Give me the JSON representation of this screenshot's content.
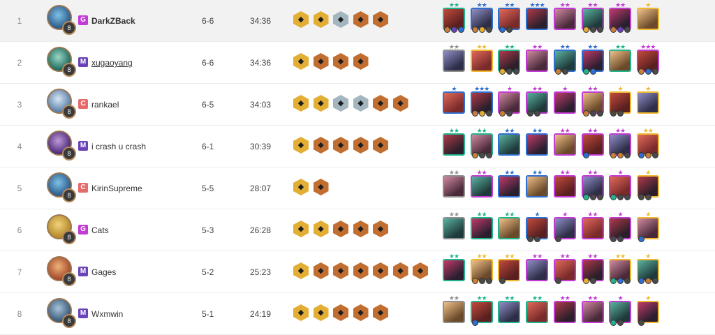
{
  "colors": {
    "tier_g": "#c23bd4",
    "tier_m": "#6a43b8",
    "tier_c": "#e66a6a",
    "cost_1": "#8f8f8f",
    "cost_2": "#20b38c",
    "cost_3": "#2f6fd1",
    "cost_4": "#c13bd2",
    "cost_5": "#f0b82e"
  },
  "rows": [
    {
      "rank": "1",
      "level": "8",
      "tier": "G",
      "name": "DarkZBack",
      "record": "6-6",
      "time": "34:36",
      "traits": [
        {
          "tone": "gold",
          "icon": "trait-icon"
        },
        {
          "tone": "gold",
          "icon": "trait-icon"
        },
        {
          "tone": "silver",
          "icon": "trait-icon"
        },
        {
          "tone": "bronze",
          "icon": "trait-icon"
        },
        {
          "tone": "bronze",
          "icon": "trait-icon"
        }
      ],
      "units": [
        {
          "cost": 2,
          "stars": "★★",
          "items": [
            "#c97f3a",
            "#6a43b8",
            "#2f6fd1"
          ]
        },
        {
          "cost": 3,
          "stars": "★★",
          "items": [
            "#c97f3a",
            "#e3ae34",
            "#4a4a4a"
          ]
        },
        {
          "cost": 3,
          "stars": "★★",
          "items": [
            "#2f6fd1",
            "#4a4a4a"
          ]
        },
        {
          "cost": 3,
          "stars": "★★★",
          "items": []
        },
        {
          "cost": 4,
          "stars": "★★",
          "items": []
        },
        {
          "cost": 4,
          "stars": "★★",
          "items": [
            "#e3ae34",
            "#4a4a4a",
            "#4a4a4a"
          ]
        },
        {
          "cost": 4,
          "stars": "★★",
          "items": [
            "#c97f3a",
            "#6a43b8",
            "#4a4a4a"
          ]
        },
        {
          "cost": 5,
          "stars": "★",
          "items": []
        }
      ]
    },
    {
      "rank": "2",
      "level": "8",
      "tier": "M",
      "name": "xugaoyang",
      "record": "6-6",
      "time": "34:36",
      "traits": [
        {
          "tone": "gold",
          "icon": "trait-icon"
        },
        {
          "tone": "bronze",
          "icon": "trait-icon"
        },
        {
          "tone": "bronze",
          "icon": "trait-icon"
        },
        {
          "tone": "bronze",
          "icon": "trait-icon"
        }
      ],
      "units": [
        {
          "cost": 1,
          "stars": "★★",
          "items": []
        },
        {
          "cost": 5,
          "stars": "★★",
          "items": []
        },
        {
          "cost": 2,
          "stars": "★★",
          "items": [
            "#e3ae34",
            "#4a4a4a",
            "#4a4a4a"
          ]
        },
        {
          "cost": 4,
          "stars": "★★",
          "items": []
        },
        {
          "cost": 3,
          "stars": "★★",
          "items": [
            "#c97f3a",
            "#4a4a4a"
          ]
        },
        {
          "cost": 3,
          "stars": "★★",
          "items": [
            "#20b38c",
            "#2f6fd1"
          ]
        },
        {
          "cost": 2,
          "stars": "★★",
          "items": []
        },
        {
          "cost": 4,
          "stars": "★★★",
          "items": [
            "#c97f3a",
            "#2f6fd1",
            "#4a4a4a"
          ]
        }
      ]
    },
    {
      "rank": "3",
      "level": "8",
      "tier": "C",
      "name": "rankael",
      "record": "6-5",
      "time": "34:03",
      "traits": [
        {
          "tone": "gold",
          "icon": "trait-icon"
        },
        {
          "tone": "gold",
          "icon": "trait-icon"
        },
        {
          "tone": "silver",
          "icon": "trait-icon"
        },
        {
          "tone": "silver",
          "icon": "trait-icon"
        },
        {
          "tone": "bronze",
          "icon": "trait-icon"
        },
        {
          "tone": "bronze",
          "icon": "trait-icon"
        }
      ],
      "units": [
        {
          "cost": 3,
          "stars": "★",
          "items": []
        },
        {
          "cost": 3,
          "stars": "★★★",
          "items": [
            "#c97f3a",
            "#e3ae34",
            "#4a4a4a"
          ]
        },
        {
          "cost": 4,
          "stars": "★",
          "items": [
            "#c97f3a",
            "#4a4a4a"
          ]
        },
        {
          "cost": 4,
          "stars": "★★",
          "items": [
            "#4a4a4a",
            "#4a4a4a"
          ]
        },
        {
          "cost": 4,
          "stars": "★",
          "items": []
        },
        {
          "cost": 4,
          "stars": "★★",
          "items": [
            "#c97f3a",
            "#4a4a4a",
            "#4a4a4a"
          ]
        },
        {
          "cost": 5,
          "stars": "★",
          "items": [
            "#4a4a4a",
            "#4a4a4a"
          ]
        },
        {
          "cost": 5,
          "stars": "★",
          "items": []
        }
      ]
    },
    {
      "rank": "4",
      "level": "8",
      "tier": "M",
      "name": "i crash u crash",
      "record": "6-1",
      "time": "30:39",
      "traits": [
        {
          "tone": "gold",
          "icon": "trait-icon"
        },
        {
          "tone": "bronze",
          "icon": "trait-icon"
        },
        {
          "tone": "bronze",
          "icon": "trait-icon"
        },
        {
          "tone": "bronze",
          "icon": "trait-icon"
        },
        {
          "tone": "bronze",
          "icon": "trait-icon"
        }
      ],
      "units": [
        {
          "cost": 2,
          "stars": "★★",
          "items": []
        },
        {
          "cost": 2,
          "stars": "★★",
          "items": [
            "#c97f3a",
            "#4a4a4a",
            "#4a4a4a"
          ]
        },
        {
          "cost": 3,
          "stars": "★★",
          "items": []
        },
        {
          "cost": 3,
          "stars": "★★",
          "items": []
        },
        {
          "cost": 4,
          "stars": "★★",
          "items": []
        },
        {
          "cost": 4,
          "stars": "★★",
          "items": [
            "#2f6fd1"
          ]
        },
        {
          "cost": 4,
          "stars": "★★",
          "items": [
            "#c97f3a",
            "#c97f3a",
            "#4a4a4a"
          ]
        },
        {
          "cost": 5,
          "stars": "★★",
          "items": [
            "#2f6fd1",
            "#c97f3a",
            "#4a4a4a"
          ]
        }
      ]
    },
    {
      "rank": "5",
      "level": "8",
      "tier": "C",
      "name": "KirinSupreme",
      "record": "5-5",
      "time": "28:07",
      "traits": [
        {
          "tone": "gold",
          "icon": "trait-icon"
        },
        {
          "tone": "bronze",
          "icon": "trait-icon"
        }
      ],
      "units": [
        {
          "cost": 1,
          "stars": "★★",
          "items": []
        },
        {
          "cost": 4,
          "stars": "★★",
          "items": []
        },
        {
          "cost": 3,
          "stars": "★★",
          "items": []
        },
        {
          "cost": 3,
          "stars": "★★",
          "items": []
        },
        {
          "cost": 4,
          "stars": "★★",
          "items": []
        },
        {
          "cost": 4,
          "stars": "★★",
          "items": [
            "#20b38c",
            "#4a4a4a",
            "#4a4a4a"
          ]
        },
        {
          "cost": 4,
          "stars": "★",
          "items": [
            "#20b38c",
            "#4a4a4a",
            "#4a4a4a"
          ]
        },
        {
          "cost": 5,
          "stars": "★",
          "items": [
            "#4a4a4a",
            "#4a4a4a"
          ]
        }
      ]
    },
    {
      "rank": "6",
      "level": "8",
      "tier": "G",
      "name": "Cats",
      "record": "5-3",
      "time": "26:28",
      "traits": [
        {
          "tone": "gold",
          "icon": "trait-icon"
        },
        {
          "tone": "gold",
          "icon": "trait-icon"
        },
        {
          "tone": "bronze",
          "icon": "trait-icon"
        },
        {
          "tone": "bronze",
          "icon": "trait-icon"
        },
        {
          "tone": "bronze",
          "icon": "trait-icon"
        }
      ],
      "units": [
        {
          "cost": 1,
          "stars": "★★",
          "items": []
        },
        {
          "cost": 2,
          "stars": "★★",
          "items": []
        },
        {
          "cost": 2,
          "stars": "★★",
          "items": []
        },
        {
          "cost": 3,
          "stars": "★",
          "items": [
            "#4a4a4a",
            "#4a4a4a"
          ]
        },
        {
          "cost": 4,
          "stars": "★",
          "items": [
            "#4a4a4a"
          ]
        },
        {
          "cost": 4,
          "stars": "★★",
          "items": []
        },
        {
          "cost": 4,
          "stars": "★",
          "items": [
            "#4a4a4a",
            "#4a4a4a"
          ]
        },
        {
          "cost": 5,
          "stars": "★",
          "items": [
            "#2f6fd1"
          ]
        }
      ]
    },
    {
      "rank": "7",
      "level": "8",
      "tier": "M",
      "name": "Gages",
      "record": "5-2",
      "time": "25:23",
      "traits": [
        {
          "tone": "gold",
          "icon": "trait-icon"
        },
        {
          "tone": "bronze",
          "icon": "trait-icon"
        },
        {
          "tone": "bronze",
          "icon": "trait-icon"
        },
        {
          "tone": "bronze",
          "icon": "trait-icon"
        },
        {
          "tone": "bronze",
          "icon": "trait-icon"
        },
        {
          "tone": "bronze",
          "icon": "trait-icon"
        },
        {
          "tone": "bronze",
          "icon": "trait-icon"
        }
      ],
      "units": [
        {
          "cost": 2,
          "stars": "★★",
          "items": []
        },
        {
          "cost": 5,
          "stars": "★★",
          "items": [
            "#c97f3a",
            "#4a4a4a",
            "#4a4a4a"
          ]
        },
        {
          "cost": 5,
          "stars": "★★",
          "items": [
            "#4a4a4a"
          ]
        },
        {
          "cost": 4,
          "stars": "★★",
          "items": []
        },
        {
          "cost": 4,
          "stars": "★★",
          "items": [
            "#4a4a4a"
          ]
        },
        {
          "cost": 4,
          "stars": "★★",
          "items": [
            "#e3ae34",
            "#4a4a4a"
          ]
        },
        {
          "cost": 5,
          "stars": "★★",
          "items": [
            "#20b38c",
            "#2f6fd1",
            "#4a4a4a"
          ]
        },
        {
          "cost": 5,
          "stars": "★",
          "items": [
            "#2f6fd1",
            "#c97f3a",
            "#4a4a4a"
          ]
        }
      ]
    },
    {
      "rank": "8",
      "level": "8",
      "tier": "M",
      "name": "Wxmwin",
      "record": "5-1",
      "time": "24:19",
      "traits": [
        {
          "tone": "gold",
          "icon": "trait-icon"
        },
        {
          "tone": "gold",
          "icon": "trait-icon"
        },
        {
          "tone": "bronze",
          "icon": "trait-icon"
        },
        {
          "tone": "bronze",
          "icon": "trait-icon"
        },
        {
          "tone": "bronze",
          "icon": "trait-icon"
        }
      ],
      "units": [
        {
          "cost": 1,
          "stars": "★★",
          "items": []
        },
        {
          "cost": 2,
          "stars": "★★",
          "items": [
            "#2f6fd1"
          ]
        },
        {
          "cost": 2,
          "stars": "★★",
          "items": []
        },
        {
          "cost": 2,
          "stars": "★★",
          "items": []
        },
        {
          "cost": 4,
          "stars": "★★",
          "items": []
        },
        {
          "cost": 4,
          "stars": "★★",
          "items": []
        },
        {
          "cost": 4,
          "stars": "★",
          "items": [
            "#20b38c",
            "#4a4a4a"
          ]
        },
        {
          "cost": 5,
          "stars": "★",
          "items": [
            "#4a4a4a"
          ]
        }
      ]
    }
  ]
}
